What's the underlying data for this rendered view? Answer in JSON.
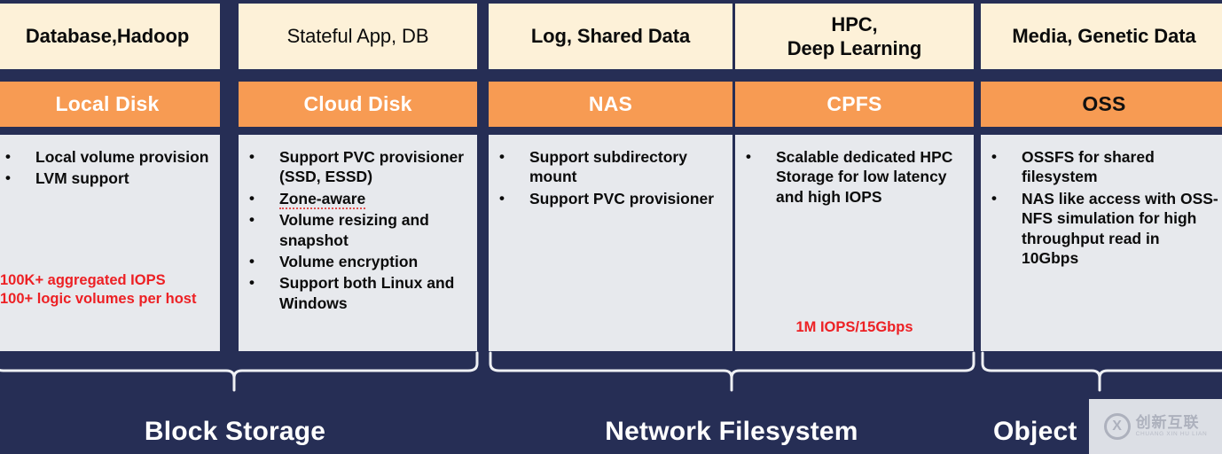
{
  "theme": {
    "background": "#262e55",
    "header_bg": "#fdf1d8",
    "band_bg": "#f79b53",
    "body_bg": "#e7e9ed",
    "accent_red": "#ed2024",
    "text_white": "#ffffff",
    "text_dark": "#0b0b0b"
  },
  "columns": [
    {
      "header": "Database, Hadoop",
      "header_plain": "Database, ",
      "header_bold": "Hadoop",
      "band": "Local Disk",
      "band_text_color": "#ffffff",
      "bullets": [
        "Local volume provision",
        "LVM support"
      ],
      "note": "100K+ aggregated IOPS\n100+ logic volumes per host",
      "note_lines": [
        "100K+ aggregated IOPS",
        "100+ logic volumes per host"
      ]
    },
    {
      "header": "Stateful App, DB",
      "band": "Cloud Disk",
      "band_text_color": "#ffffff",
      "bullets": [
        "Support PVC provisioner (SSD, ESSD)",
        "Zone-aware",
        "Volume resizing and snapshot",
        "Volume encryption",
        "Support both Linux and Windows"
      ],
      "note_lines": []
    },
    {
      "header": "Log, Shared Data",
      "band": "NAS",
      "band_text_color": "#ffffff",
      "bullets": [
        "Support subdirectory mount",
        "Support PVC provisioner"
      ],
      "note_lines": []
    },
    {
      "header": "HPC,\nDeep Learning",
      "header_line1": "HPC,",
      "header_line2": "Deep Learning",
      "band": "CPFS",
      "band_text_color": "#ffffff",
      "bullets": [
        "Scalable dedicated HPC Storage for low latency and high IOPS"
      ],
      "note_lines": [
        "1M IOPS/15Gbps"
      ]
    },
    {
      "header": "Media, Genetic Data",
      "band": "OSS",
      "band_text_color": "#111111",
      "bullets": [
        "OSSFS for shared filesystem",
        "NAS like access with OSS-NFS simulation for high throughput read in 10Gbps"
      ],
      "note_lines": []
    }
  ],
  "groups": [
    {
      "label": "Block Storage"
    },
    {
      "label": "Network Filesystem"
    },
    {
      "label": "Object"
    }
  ],
  "watermark": {
    "logo": "X",
    "cn": "创新互联",
    "pinyin": "CHUANG XIN HU LIAN"
  }
}
